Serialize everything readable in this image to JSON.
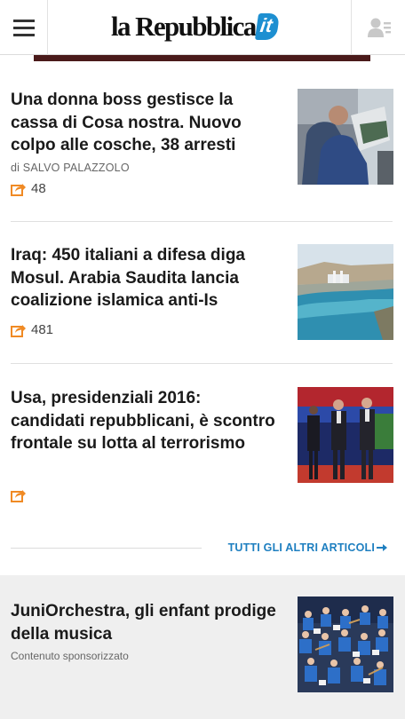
{
  "header": {
    "logo_main": "la Repubblica",
    "logo_suffix": "it"
  },
  "articles": [
    {
      "title": "Una donna boss gestisce la cassa di Cosa nostra. Nuovo colpo alle cosche, 38 arresti",
      "byline": "di SALVO PALAZZOLO",
      "shares": "48"
    },
    {
      "title": "Iraq: 450 italiani a difesa diga Mosul. Arabia Saudita lancia coalizione islamica anti-Is",
      "shares": "481"
    },
    {
      "title": "Usa, presidenziali 2016: candidati repubblicani, è scontro frontale su lotta al terrorismo",
      "shares": ""
    }
  ],
  "more_link": "TUTTI GLI ALTRI ARTICOLI",
  "sponsored": {
    "title": "JuniOrchestra, gli enfant prodige della musica",
    "label": "Contenuto sponsorizzato"
  },
  "colors": {
    "accent_blue": "#1e7fc0",
    "share_orange": "#f08a24",
    "logo_it_blue": "#1d8fd1"
  }
}
